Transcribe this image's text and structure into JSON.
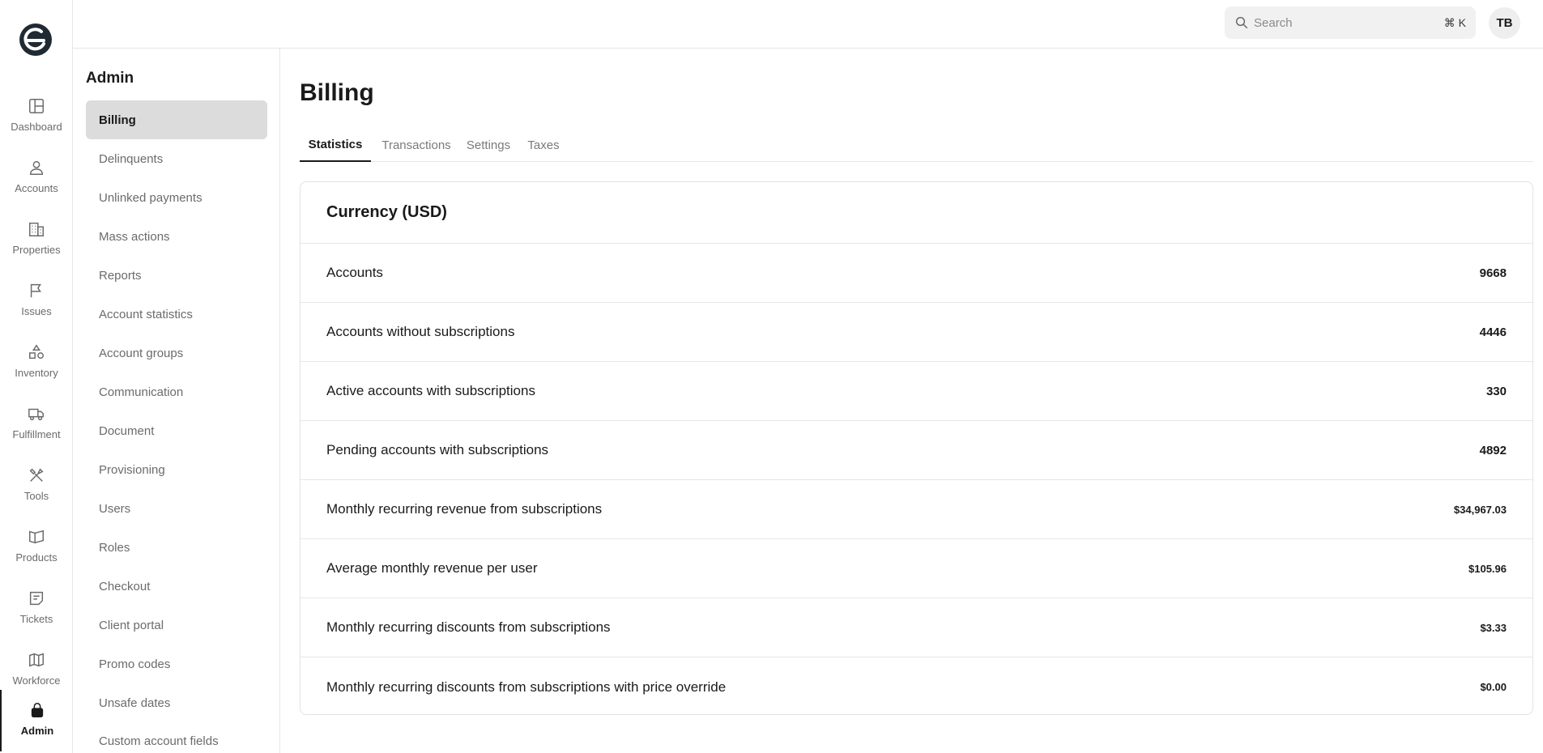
{
  "rail": {
    "items": [
      {
        "label": "Dashboard",
        "icon": "dashboard-icon"
      },
      {
        "label": "Accounts",
        "icon": "user-icon"
      },
      {
        "label": "Properties",
        "icon": "building-icon"
      },
      {
        "label": "Issues",
        "icon": "flag-icon"
      },
      {
        "label": "Inventory",
        "icon": "shapes-icon"
      },
      {
        "label": "Fulfillment",
        "icon": "truck-icon"
      },
      {
        "label": "Tools",
        "icon": "tools-icon"
      },
      {
        "label": "Products",
        "icon": "book-icon"
      },
      {
        "label": "Tickets",
        "icon": "ticket-icon"
      },
      {
        "label": "Workforce",
        "icon": "map-icon"
      },
      {
        "label": "Admin",
        "icon": "lock-icon"
      }
    ]
  },
  "topbar": {
    "search_placeholder": "Search",
    "search_shortcut": "⌘ K",
    "avatar_initials": "TB"
  },
  "subnav": {
    "title": "Admin",
    "items": [
      "Billing",
      "Delinquents",
      "Unlinked payments",
      "Mass actions",
      "Reports",
      "Account statistics",
      "Account groups",
      "Communication",
      "Document",
      "Provisioning",
      "Users",
      "Roles",
      "Checkout",
      "Client portal",
      "Promo codes",
      "Unsafe dates",
      "Custom account fields"
    ]
  },
  "main": {
    "title": "Billing",
    "tabs": [
      "Statistics",
      "Transactions",
      "Settings",
      "Taxes"
    ],
    "card": {
      "title": "Currency (USD)",
      "rows": [
        {
          "label": "Accounts",
          "value": "9668"
        },
        {
          "label": "Accounts without subscriptions",
          "value": "4446"
        },
        {
          "label": "Active accounts with subscriptions",
          "value": "330"
        },
        {
          "label": "Pending accounts with subscriptions",
          "value": "4892"
        },
        {
          "label": "Monthly recurring revenue from subscriptions",
          "value": "$34,967.03"
        },
        {
          "label": "Average monthly revenue per user",
          "value": "$105.96"
        },
        {
          "label": "Monthly recurring discounts from subscriptions",
          "value": "$3.33"
        },
        {
          "label": "Monthly recurring discounts from subscriptions with price override",
          "value": "$0.00"
        }
      ]
    }
  }
}
